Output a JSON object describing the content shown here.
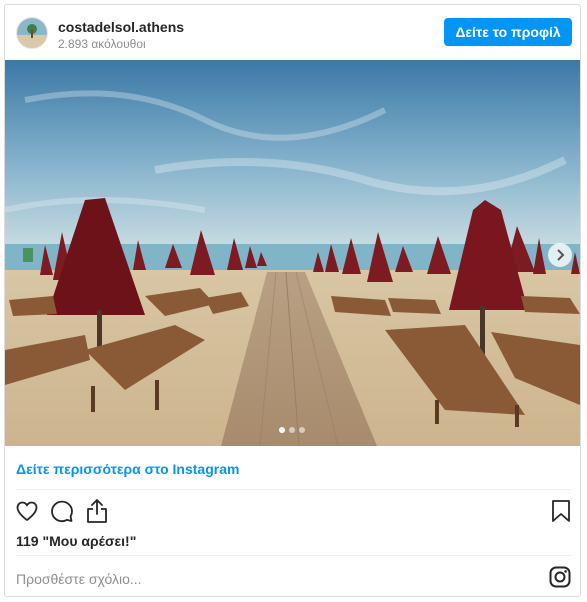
{
  "header": {
    "username": "costadelsol.athens",
    "followers": "2.893 ακόλουθοι",
    "profile_button": "Δείτε το προφίλ"
  },
  "post": {
    "carousel": {
      "current": 1,
      "total": 3
    }
  },
  "more_link": "Δείτε περισσότερα στο Instagram",
  "actions": {
    "likes": "119 \"Μου αρέσει!\""
  },
  "comment": {
    "placeholder": "Προσθέστε σχόλιο..."
  },
  "icons": [
    "heart-icon",
    "comment-icon",
    "share-icon",
    "bookmark-icon",
    "chevron-right-icon",
    "instagram-icon"
  ],
  "colors": {
    "accent": "#0095f6",
    "text": "#262626",
    "muted": "#8e8e8e",
    "border": "#dbdbdb"
  }
}
